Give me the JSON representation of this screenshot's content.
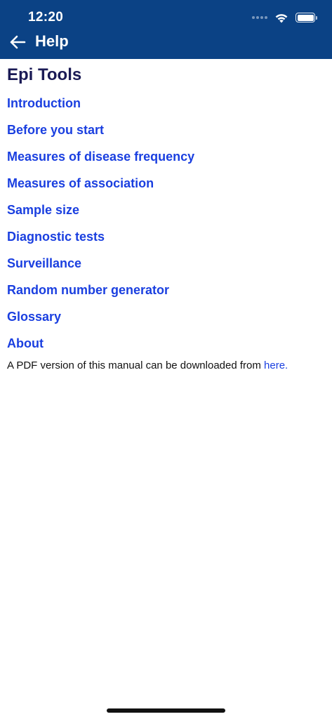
{
  "status_bar": {
    "time": "12:20",
    "icons": [
      "signal-icon",
      "wifi-icon",
      "battery-icon"
    ]
  },
  "nav": {
    "title": "Help",
    "back_icon": "arrow-left-icon"
  },
  "page": {
    "heading": "Epi Tools",
    "items": [
      {
        "label": "Introduction"
      },
      {
        "label": "Before you start"
      },
      {
        "label": "Measures of disease frequency"
      },
      {
        "label": "Measures of association"
      },
      {
        "label": "Sample size"
      },
      {
        "label": "Diagnostic tests"
      },
      {
        "label": "Surveillance"
      },
      {
        "label": "Random number generator"
      },
      {
        "label": "Glossary"
      },
      {
        "label": "About"
      }
    ],
    "footer_text": "A PDF version of this manual can be downloaded from ",
    "footer_link": "here."
  },
  "colors": {
    "header_bg": "#0b4285",
    "link": "#1a3fe0",
    "heading": "#1a1a55"
  }
}
